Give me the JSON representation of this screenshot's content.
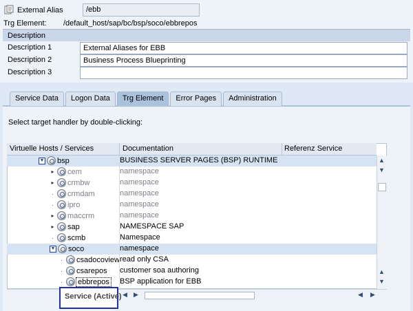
{
  "header": {
    "alias_label": "External Alias",
    "alias_value": "/ebb",
    "trg_label": "Trg Element:",
    "trg_value": "/default_host/sap/bc/bsp/soco/ebbrepos"
  },
  "description": {
    "section_title": "Description",
    "rows": [
      {
        "label": "Description 1",
        "value": "External Aliases for EBB"
      },
      {
        "label": "Description 2",
        "value": "Business Process Blueprinting"
      },
      {
        "label": "Description 3",
        "value": ""
      }
    ]
  },
  "tabs": [
    {
      "label": "Service Data",
      "active": false
    },
    {
      "label": "Logon Data",
      "active": false
    },
    {
      "label": "Trg Element",
      "active": true
    },
    {
      "label": "Error Pages",
      "active": false
    },
    {
      "label": "Administration",
      "active": false
    }
  ],
  "instruction": "Select target handler by double-clicking:",
  "tree": {
    "columns": [
      "Virtuelle Hosts / Services",
      "Documentation",
      "Referenz Service"
    ],
    "rows": [
      {
        "name": "bsp",
        "doc": "BUSINESS SERVER PAGES (BSP) RUNTIME",
        "level": 0,
        "toggle": "expanded",
        "gray": false
      },
      {
        "name": "cem",
        "doc": "namespace",
        "level": 1,
        "toggle": "collapsed",
        "gray": true
      },
      {
        "name": "crmbw",
        "doc": "namespace",
        "level": 1,
        "toggle": "collapsed",
        "gray": true
      },
      {
        "name": "crmdam",
        "doc": "namespace",
        "level": 1,
        "toggle": "leaf",
        "gray": true
      },
      {
        "name": "ipro",
        "doc": "namespace",
        "level": 1,
        "toggle": "leaf",
        "gray": true
      },
      {
        "name": "maccrm",
        "doc": "namespace",
        "level": 1,
        "toggle": "collapsed",
        "gray": true
      },
      {
        "name": "sap",
        "doc": "NAMESPACE SAP",
        "level": 1,
        "toggle": "collapsed",
        "gray": false
      },
      {
        "name": "scmb",
        "doc": "Namespace",
        "level": 1,
        "toggle": "leaf",
        "gray": false
      },
      {
        "name": "soco",
        "doc": "namespace",
        "level": 1,
        "toggle": "expanded",
        "gray": false
      },
      {
        "name": "csadocoview",
        "doc": "read only CSA",
        "level": 2,
        "toggle": "leaf",
        "gray": false
      },
      {
        "name": "csarepos",
        "doc": "customer soa authoring",
        "level": 2,
        "toggle": "leaf",
        "gray": false
      },
      {
        "name": "ebbrepos",
        "doc": "BSP application for EBB",
        "level": 2,
        "toggle": "leaf",
        "gray": false
      }
    ]
  },
  "tooltip": "Service (Active)",
  "icons": {
    "alias": "alias-icon",
    "node": "globe-service-icon",
    "expanded": "collapse-triangle-icon",
    "collapsed": "expand-arrow-icon"
  },
  "colors": {
    "background": "#dfe9f5",
    "tab_active": "#aac2dc",
    "selection": "#d5e3f3",
    "tooltip_border": "#1f2fa8"
  }
}
